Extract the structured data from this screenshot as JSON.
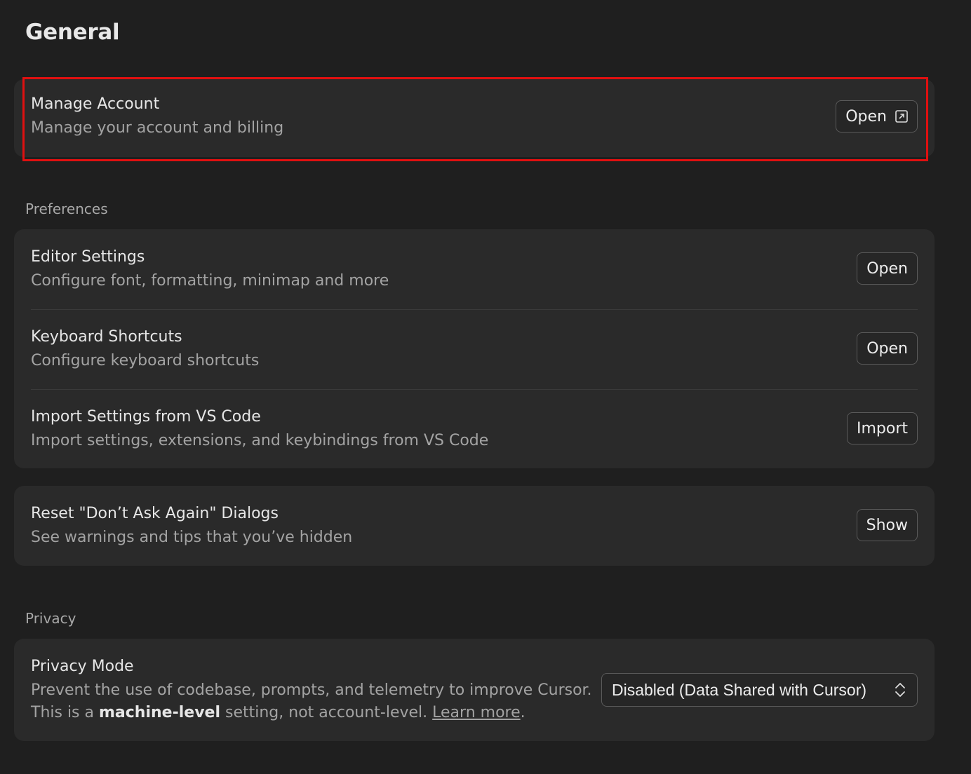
{
  "page": {
    "title": "General"
  },
  "account": {
    "title": "Manage Account",
    "description": "Manage your account and billing",
    "button_label": "Open"
  },
  "preferences": {
    "section_label": "Preferences",
    "items": [
      {
        "title": "Editor Settings",
        "description": "Configure font, formatting, minimap and more",
        "button_label": "Open"
      },
      {
        "title": "Keyboard Shortcuts",
        "description": "Configure keyboard shortcuts",
        "button_label": "Open"
      },
      {
        "title": "Import Settings from VS Code",
        "description": "Import settings, extensions, and keybindings from VS Code",
        "button_label": "Import"
      }
    ]
  },
  "dialogs": {
    "title": "Reset \"Don’t Ask Again\" Dialogs",
    "description": "See warnings and tips that you’ve hidden",
    "button_label": "Show"
  },
  "privacy": {
    "section_label": "Privacy",
    "title": "Privacy Mode",
    "description_line1": "Prevent the use of codebase, prompts, and telemetry to improve Cursor.",
    "description_line2_prefix": "This is a ",
    "description_line2_bold": "machine-level",
    "description_line2_middle": " setting, not account-level. ",
    "learn_more_label": "Learn more",
    "description_line2_suffix": ".",
    "select_value": "Disabled (Data Shared with Cursor)"
  },
  "icons": {
    "external_link": "external-link-icon",
    "select_chevrons": "chevron-up-down-icon"
  },
  "colors": {
    "background": "#1f1f1f",
    "card": "#2a2a2a",
    "highlight_border": "#e01010"
  }
}
